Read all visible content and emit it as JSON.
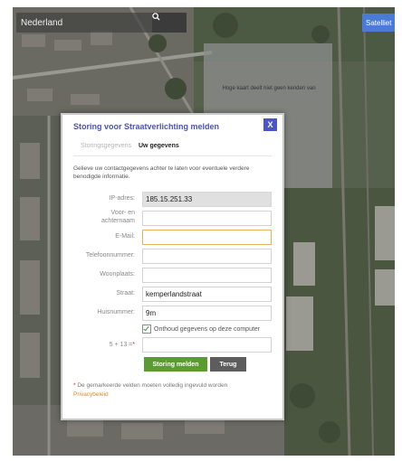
{
  "map": {
    "search_value": "Nederland",
    "satellite_label": "Satelliet",
    "notice_text": "Hoge kaart deelt niet geen kenden van"
  },
  "dialog": {
    "title": "Storing voor Straatverlichting melden",
    "close_label": "X",
    "tabs": [
      {
        "label": "Storingsgegevens",
        "active": false
      },
      {
        "label": "Uw gegevens",
        "active": true
      }
    ],
    "intro": "Gelieve uw contactgegevens achter te laten voor eventuele verdere benodigde informatie.",
    "fields": {
      "ip": {
        "label": "IP-adres:",
        "value": "185.15.251.33"
      },
      "name_line1": "Voor- en",
      "name_line2": "achternaam",
      "email": {
        "label": "E-Mail:",
        "value": ""
      },
      "phone": {
        "label": "Telefoonnummer:",
        "value": ""
      },
      "city": {
        "label": "Woonplaats:",
        "value": ""
      },
      "street": {
        "label": "Straat:",
        "value": "kemperlandstraat"
      },
      "housenumber": {
        "label": "Huisnummer:",
        "value": "9m"
      }
    },
    "remember_label": "Onthoud gegevens op deze computer",
    "captcha": {
      "question": "5 + 13 =",
      "star": "*",
      "value": ""
    },
    "submit_label": "Storing melden",
    "back_label": "Terug",
    "footnote_star": "*",
    "footnote": "De gemarkeerde velden moeten volledig ingevuld worden",
    "privacy_label": "Privacybeleid"
  },
  "colors": {
    "title": "#4a55a8",
    "submit": "#5a9b32",
    "back": "#5d5d5d",
    "privacy_link": "#e08a2a"
  }
}
